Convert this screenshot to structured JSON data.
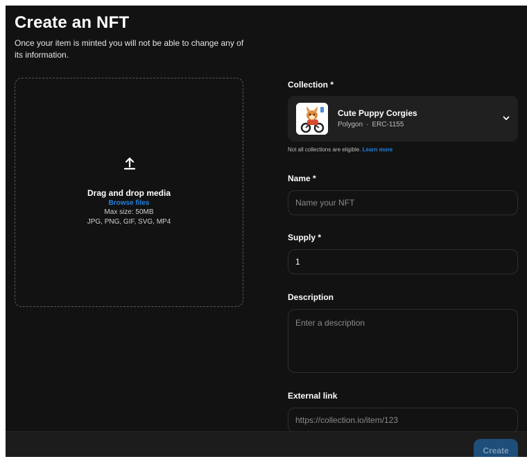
{
  "page": {
    "title": "Create an NFT",
    "subtitle": "Once your item is minted you will not be able to change any of its information."
  },
  "dropzone": {
    "icon": "upload-icon",
    "title": "Drag and drop media",
    "browse_label": "Browse files",
    "max_size": "Max size: 50MB",
    "formats": "JPG, PNG, GIF, SVG, MP4"
  },
  "collection": {
    "label": "Collection *",
    "selected_name": "Cute Puppy Corgies",
    "chain": "Polygon",
    "standard": "ERC-1155",
    "separator": "·",
    "hint": "Not all collections are eligible.",
    "hint_link": "Learn more"
  },
  "fields": {
    "name": {
      "label": "Name *",
      "value": "",
      "placeholder": "Name your NFT"
    },
    "supply": {
      "label": "Supply *",
      "value": "1",
      "placeholder": ""
    },
    "description": {
      "label": "Description",
      "value": "",
      "placeholder": "Enter a description"
    },
    "external_link": {
      "label": "External link",
      "value": "",
      "placeholder": "https://collection.io/item/123"
    }
  },
  "footer": {
    "create_label": "Create"
  },
  "colors": {
    "background": "#121212",
    "accent": "#2081e2",
    "disabled_button": "#1e4e7a"
  }
}
